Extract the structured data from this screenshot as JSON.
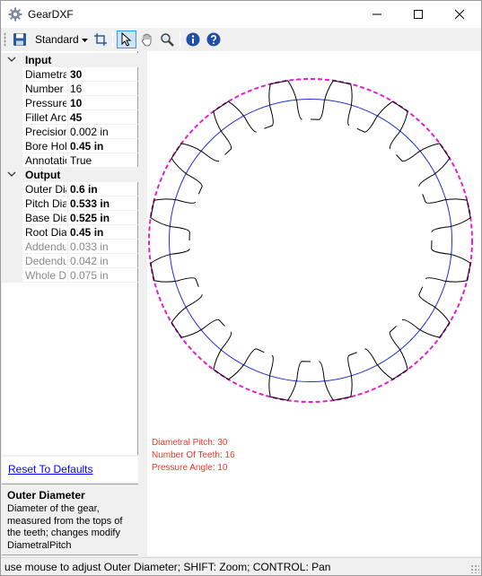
{
  "window": {
    "title": "GearDXF"
  },
  "toolbar": {
    "standard_label": "Standard",
    "buttons": [
      "save-icon",
      "dropdown-arrow-icon",
      "crop-icon",
      "pointer-icon",
      "hand-icon",
      "zoom-icon",
      "info-icon",
      "help-icon"
    ]
  },
  "properties": {
    "input": {
      "label": "Input",
      "rows": [
        {
          "name": "Diametral Pitch",
          "value": "30",
          "bold": true
        },
        {
          "name": "Number of Teeth",
          "value": "16",
          "bold": false
        },
        {
          "name": "Pressure Angle",
          "value": "10",
          "bold": true
        },
        {
          "name": "Fillet Arc Radius",
          "value": "45",
          "bold": true
        },
        {
          "name": "Precision",
          "value": "0.002 in",
          "bold": false
        },
        {
          "name": "Bore Hole Diameter",
          "value": "0.45 in",
          "bold": true
        },
        {
          "name": "Annotations",
          "value": "True",
          "bold": false
        }
      ]
    },
    "output": {
      "label": "Output",
      "rows": [
        {
          "name": "Outer Diameter",
          "value": "0.6 in",
          "bold": true,
          "disabled": false
        },
        {
          "name": "Pitch Diameter",
          "value": "0.533 in",
          "bold": true,
          "disabled": false
        },
        {
          "name": "Base Diameter",
          "value": "0.525 in",
          "bold": true,
          "disabled": false
        },
        {
          "name": "Root Diameter",
          "value": "0.45 in",
          "bold": true,
          "disabled": false
        },
        {
          "name": "Addendum",
          "value": "0.033 in",
          "bold": false,
          "disabled": true
        },
        {
          "name": "Dedendum",
          "value": "0.042 in",
          "bold": false,
          "disabled": true
        },
        {
          "name": "Whole Depth",
          "value": "0.075 in",
          "bold": false,
          "disabled": true
        }
      ]
    }
  },
  "reset_link": "Reset To Defaults",
  "help": {
    "title": "Outer Diameter",
    "description": "Diameter of the gear, measured from the tops of the teeth; changes modify DiametralPitch"
  },
  "annotations": {
    "pitch": "Diametral Pitch: 30",
    "teeth": "Number Of Teeth: 16",
    "pressure": "Pressure Angle: 10"
  },
  "status": "use mouse to adjust Outer Diameter; SHIFT: Zoom; CONTROL: Pan",
  "gear": {
    "teeth": 16,
    "outer_diameter_in": 0.6,
    "base_diameter_in": 0.525,
    "root_diameter_in": 0.45
  },
  "colors": {
    "outer_circle": "#e020d0",
    "base_circle": "#1f2fd8",
    "tooth_outline": "#000000",
    "annotation_text": "#e8372b",
    "link": "#0000ee"
  }
}
